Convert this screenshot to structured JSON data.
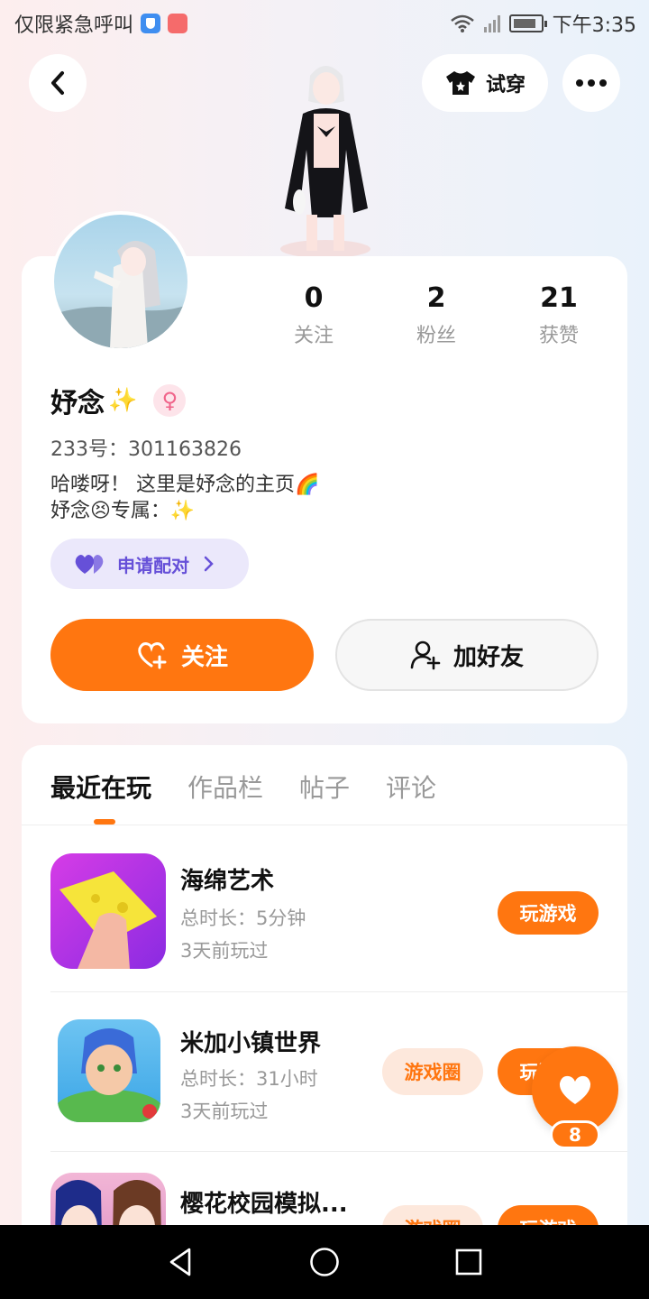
{
  "status_bar": {
    "carrier_text": "仅限紧急呼叫",
    "time": "下午3:35",
    "icons": [
      "shield-icon",
      "shopping-bag-icon",
      "wifi-icon",
      "signal-icon",
      "battery-charging-icon"
    ]
  },
  "header": {
    "dress_label": "试穿",
    "icons": [
      "back-arrow-icon",
      "tshirt-icon",
      "more-dots-icon"
    ]
  },
  "profile": {
    "stats": [
      {
        "num": "0",
        "label": "关注"
      },
      {
        "num": "2",
        "label": "粉丝"
      },
      {
        "num": "21",
        "label": "获赞"
      }
    ],
    "name": "妤念",
    "name_sparkle": "✨",
    "gender_symbol": "♀",
    "uid": "233号：301163826",
    "bio_line1": "哈喽呀！ 这里是妤念的主页🌈",
    "bio_line2": "妤念😣专属：✨",
    "pair_label": "申请配对",
    "follow_label": "关注",
    "add_friend_label": "加好友"
  },
  "tabs": [
    {
      "label": "最近在玩",
      "active": true
    },
    {
      "label": "作品栏",
      "active": false
    },
    {
      "label": "帖子",
      "active": false
    },
    {
      "label": "评论",
      "active": false
    }
  ],
  "games": [
    {
      "name": "海绵艺术",
      "duration": "总时长：5分钟",
      "last_played": "3天前玩过",
      "play_label": "玩游戏"
    },
    {
      "name": "米加小镇世界",
      "duration": "总时长：31小时",
      "last_played": "3天前玩过",
      "circle_label": "游戏圈",
      "play_label": "玩游戏"
    },
    {
      "name": "樱花校园模拟...",
      "circle_label": "游戏圈",
      "play_label": "玩游戏"
    }
  ],
  "like_fab": {
    "count": "8"
  },
  "nav": {
    "icons": [
      "back-triangle-icon",
      "home-circle-icon",
      "recents-square-icon"
    ]
  },
  "colors": {
    "accent": "#ff7610",
    "pair_purple": "#6650d8",
    "text_gray": "#999999"
  }
}
